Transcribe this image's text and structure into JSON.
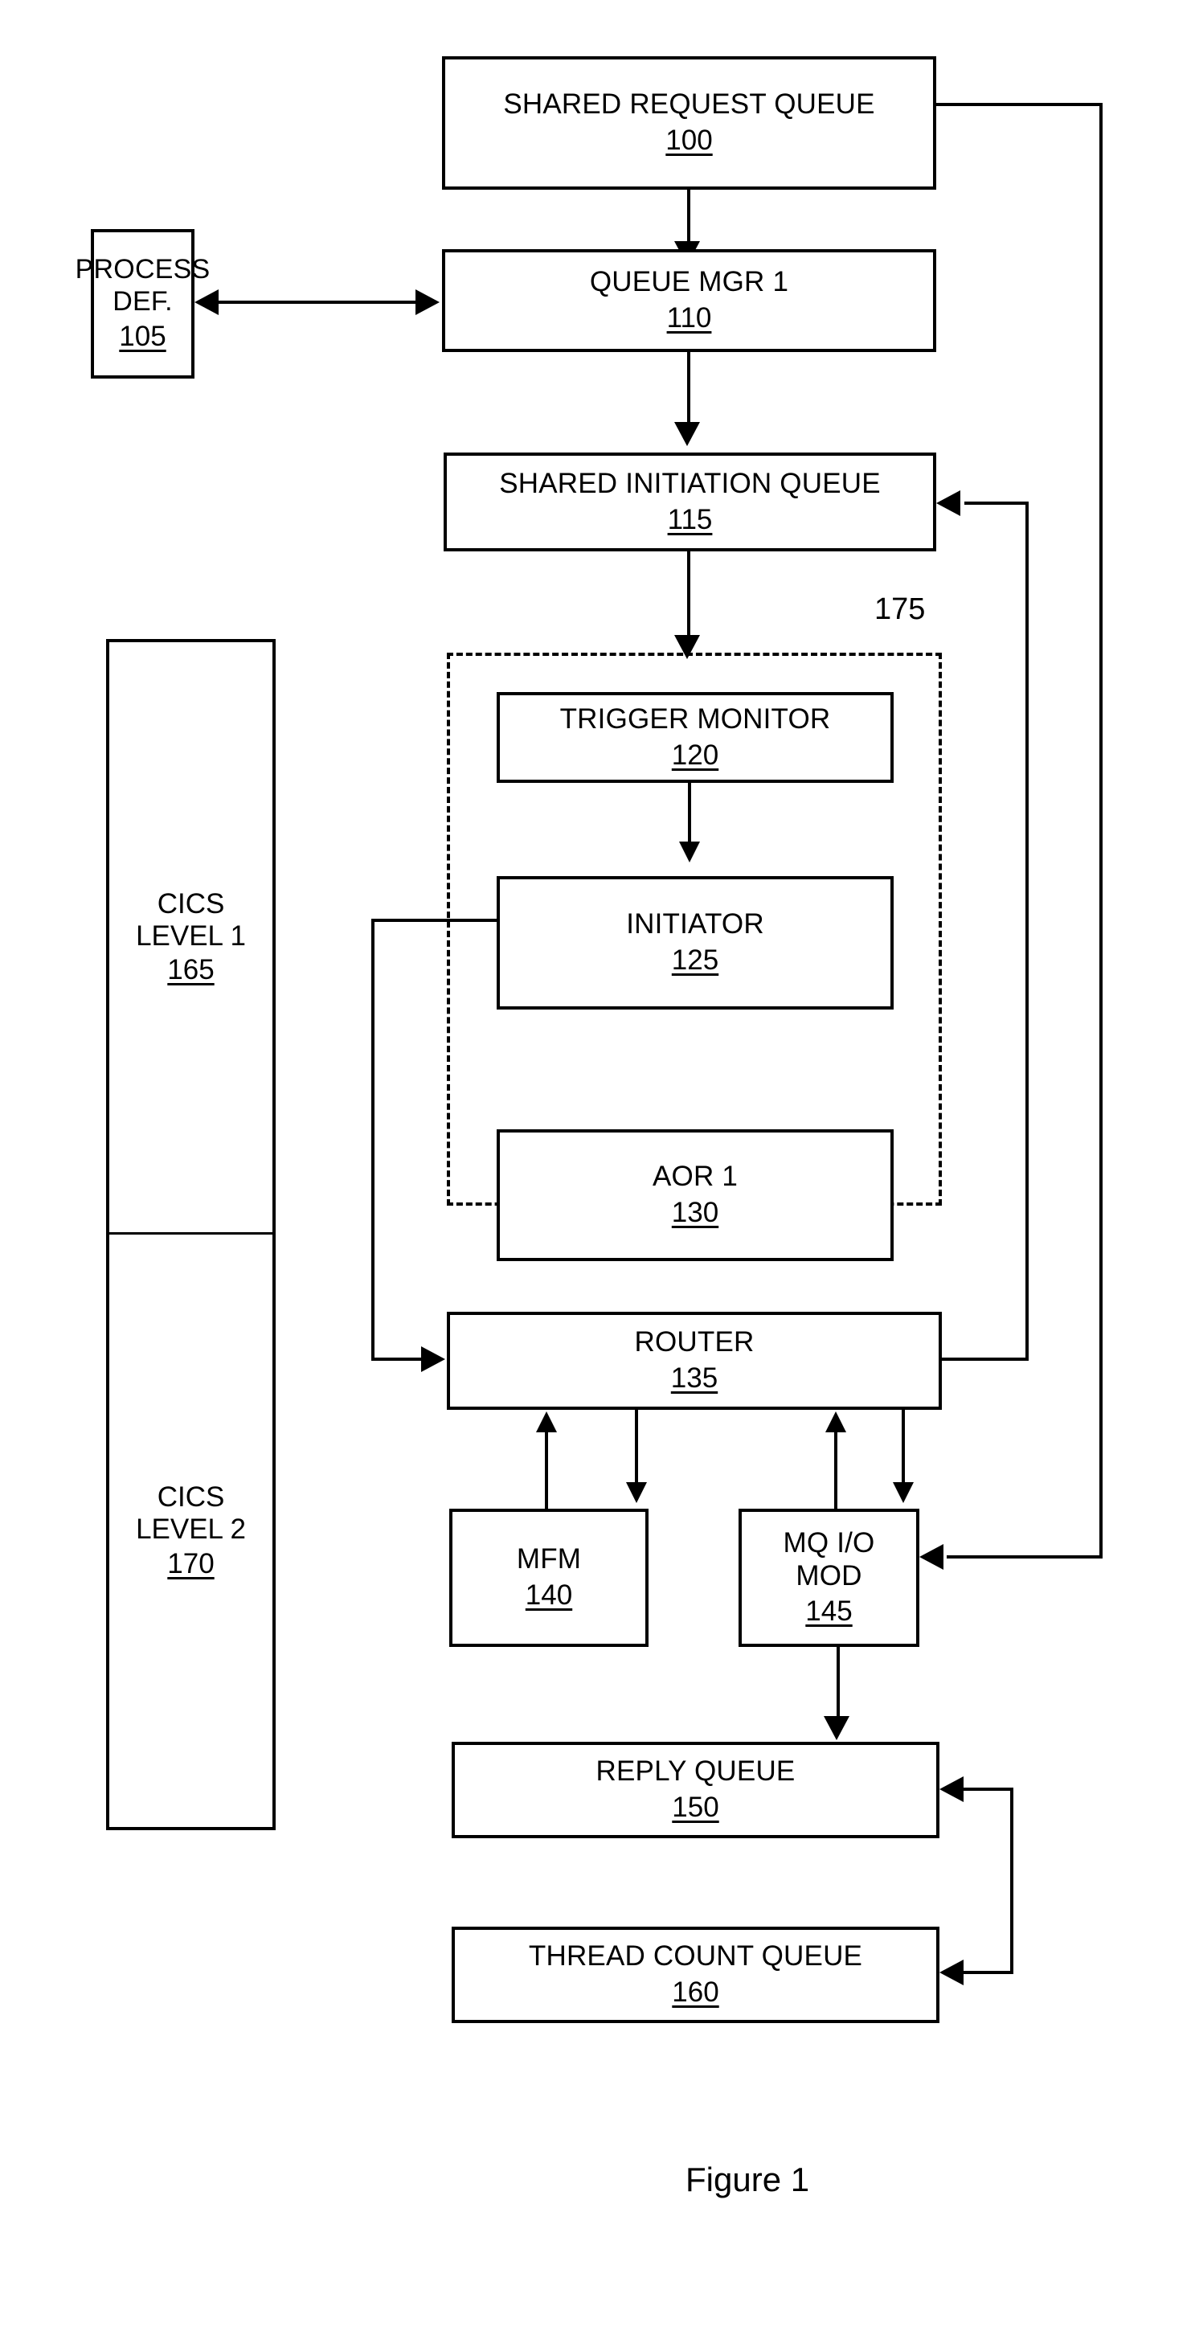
{
  "figure": {
    "caption": "Figure 1",
    "group_label": "175"
  },
  "nodes": {
    "shared_request_queue": {
      "title": "SHARED REQUEST QUEUE",
      "ref": "100"
    },
    "process_def": {
      "title_line1": "PROCESS",
      "title_line2": "DEF.",
      "ref": "105"
    },
    "queue_mgr_1": {
      "title": "QUEUE MGR 1",
      "ref": "110"
    },
    "shared_initiation_queue": {
      "title": "SHARED INITIATION QUEUE",
      "ref": "115"
    },
    "trigger_monitor": {
      "title": "TRIGGER MONITOR",
      "ref": "120"
    },
    "initiator": {
      "title": "INITIATOR",
      "ref": "125"
    },
    "aor_1": {
      "title": "AOR 1",
      "ref": "130"
    },
    "router": {
      "title": "ROUTER",
      "ref": "135"
    },
    "mfm": {
      "title": "MFM",
      "ref": "140"
    },
    "mq_io_mod": {
      "title_line1": "MQ I/O",
      "title_line2": "MOD",
      "ref": "145"
    },
    "reply_queue": {
      "title": "REPLY QUEUE",
      "ref": "150"
    },
    "thread_count_queue": {
      "title": "THREAD COUNT QUEUE",
      "ref": "160"
    },
    "cics_level_1": {
      "title_line1": "CICS",
      "title_line2": "LEVEL 1",
      "ref": "165"
    },
    "cics_level_2": {
      "title_line1": "CICS",
      "title_line2": "LEVEL 2",
      "ref": "170"
    }
  },
  "colors": {
    "stroke": "#000000",
    "background": "#ffffff"
  }
}
